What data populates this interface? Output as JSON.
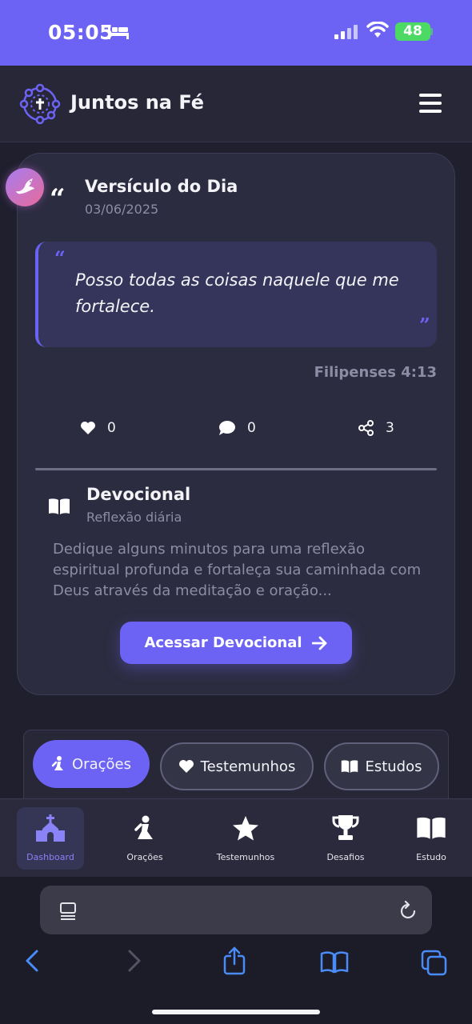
{
  "status_bar": {
    "time": "05:05",
    "battery": "48",
    "bg_color": "#6c63f5"
  },
  "header": {
    "title": "Juntos na Fé",
    "logo_icon": "community-circle-logo",
    "menu_icon": "hamburger-menu"
  },
  "verse_card": {
    "title": "Versículo do Dia",
    "date": "03/06/2025",
    "verse": "Posso todas as coisas naquele que me fortalece.",
    "open_quote": "“",
    "close_quote": "”",
    "quote_icon": "“",
    "reference": "Filipenses 4:13",
    "likes": "0",
    "comments": "0",
    "shares": "3"
  },
  "devotional": {
    "title": "Devocional",
    "subtitle": "Reflexão diária",
    "text": "Dedique alguns minutos para uma reflexão espiritual profunda e fortaleça sua caminhada com Deus através da meditação e oração...",
    "button_label": "Acessar Devocional"
  },
  "tabs": [
    {
      "label": "Orações",
      "active": true
    },
    {
      "label": "Testemunhos",
      "active": false
    },
    {
      "label": "Estudos",
      "active": false
    }
  ],
  "bottom_nav": [
    {
      "label": "Dashboard",
      "icon": "church-icon",
      "active": true
    },
    {
      "label": "Orações",
      "icon": "praying-icon",
      "active": false
    },
    {
      "label": "Testemunhos",
      "icon": "star-icon",
      "active": false
    },
    {
      "label": "Desafios",
      "icon": "trophy-icon",
      "active": false
    },
    {
      "label": "Estudo",
      "icon": "book-open-icon",
      "active": false
    }
  ],
  "colors": {
    "accent": "#6c63f5",
    "background": "#1f1f2e",
    "card": "#2c2c40",
    "muted_text": "#8c8ca4"
  }
}
